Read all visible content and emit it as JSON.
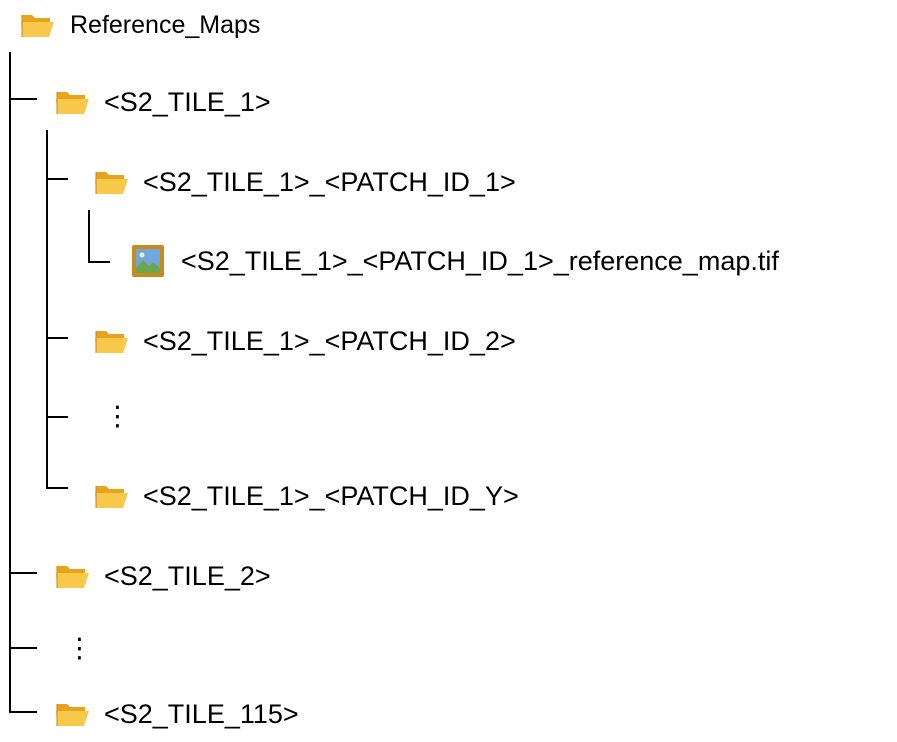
{
  "root": {
    "label": "Reference_Maps",
    "icon": "folder-open-icon"
  },
  "nodes": [
    {
      "id": "tile-1",
      "label": "<S2_TILE_1>",
      "icon": "folder-open-icon"
    },
    {
      "id": "tile-1-patch-1",
      "label": "<S2_TILE_1>_<PATCH_ID_1>",
      "icon": "folder-open-icon"
    },
    {
      "id": "tile-1-patch-1-file",
      "label": "<S2_TILE_1>_<PATCH_ID_1>_reference_map.tif",
      "icon": "image-file-icon"
    },
    {
      "id": "tile-1-patch-2",
      "label": "<S2_TILE_1>_<PATCH_ID_2>",
      "icon": "folder-open-icon"
    },
    {
      "id": "tile-1-ellipsis",
      "label": "⋮",
      "icon": ""
    },
    {
      "id": "tile-1-patch-y",
      "label": "<S2_TILE_1>_<PATCH_ID_Y>",
      "icon": "folder-open-icon"
    },
    {
      "id": "tile-2",
      "label": "<S2_TILE_2>",
      "icon": "folder-open-icon"
    },
    {
      "id": "root-ellipsis",
      "label": "⋮",
      "icon": ""
    },
    {
      "id": "tile-115",
      "label": "<S2_TILE_115>",
      "icon": "folder-open-icon"
    }
  ],
  "colors": {
    "folder_back": "#E8A21C",
    "folder_front": "#F7C84A",
    "image_frame": "#C98A1E",
    "image_sky": "#6FA8DC",
    "image_ground": "#6AA84F",
    "line": "#000000"
  }
}
